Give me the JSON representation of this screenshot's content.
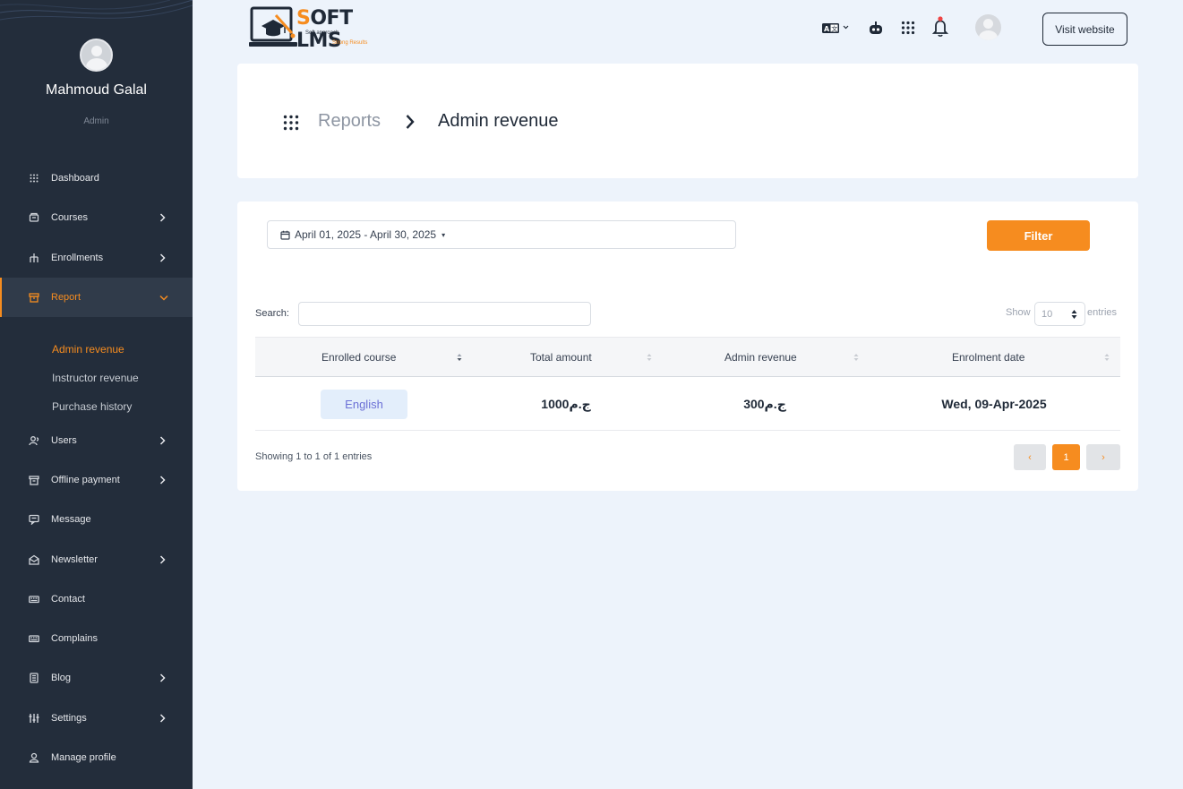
{
  "sidebar": {
    "profile": {
      "name": "Mahmoud Galal",
      "role": "Admin"
    },
    "items": [
      {
        "label": "Dashboard",
        "icon": "grid-icon",
        "has_children": false
      },
      {
        "label": "Courses",
        "icon": "courses-icon",
        "has_children": true
      },
      {
        "label": "Enrollments",
        "icon": "enrollments-icon",
        "has_children": true
      },
      {
        "label": "Report",
        "icon": "report-icon",
        "has_children": true,
        "active": true,
        "expanded": true
      },
      {
        "label": "Users",
        "icon": "users-icon",
        "has_children": true
      },
      {
        "label": "Offline payment",
        "icon": "offline-payment-icon",
        "has_children": true
      },
      {
        "label": "Message",
        "icon": "message-icon",
        "has_children": false
      },
      {
        "label": "Newsletter",
        "icon": "newsletter-icon",
        "has_children": true
      },
      {
        "label": "Contact",
        "icon": "contact-icon",
        "has_children": false
      },
      {
        "label": "Complains",
        "icon": "complains-icon",
        "has_children": false
      },
      {
        "label": "Blog",
        "icon": "blog-icon",
        "has_children": true
      },
      {
        "label": "Settings",
        "icon": "settings-icon",
        "has_children": true
      },
      {
        "label": "Manage profile",
        "icon": "profile-icon",
        "has_children": false
      }
    ],
    "report_submenu": [
      {
        "label": "Admin revenue",
        "active": true
      },
      {
        "label": "Instructor revenue",
        "active": false
      },
      {
        "label": "Purchase history",
        "active": false
      }
    ]
  },
  "header": {
    "logo": {
      "text_s": "S",
      "text_rest": "OFT LMS",
      "tagline1": "Soft approach",
      "tagline2": "Strong Results"
    },
    "visit_website_label": "Visit website"
  },
  "breadcrumb": {
    "parent": "Reports",
    "current": "Admin revenue"
  },
  "filter": {
    "date_range": "April 01, 2025 - April 30, 2025",
    "filter_label": "Filter"
  },
  "table_controls": {
    "search_label": "Search:",
    "search_value": "",
    "show_label": "Show",
    "page_length": "10",
    "entries_label": "entries"
  },
  "table": {
    "columns": [
      "Enrolled course",
      "Total amount",
      "Admin revenue",
      "Enrolment date"
    ],
    "rows": [
      {
        "course": "English",
        "total_amount": "1000ج.م",
        "admin_revenue": "300ج.م",
        "date": "Wed, 09-Apr-2025"
      }
    ],
    "info": "Showing 1 to 1 of 1 entries",
    "pagination": {
      "prev": "‹",
      "current_page": "1",
      "next": "›"
    }
  },
  "colors": {
    "accent": "#f68c1f",
    "sidebar_bg": "#232d3b",
    "page_bg": "#edf3fb",
    "badge_bg": "#e3eefb",
    "badge_text": "#6b70d6"
  }
}
